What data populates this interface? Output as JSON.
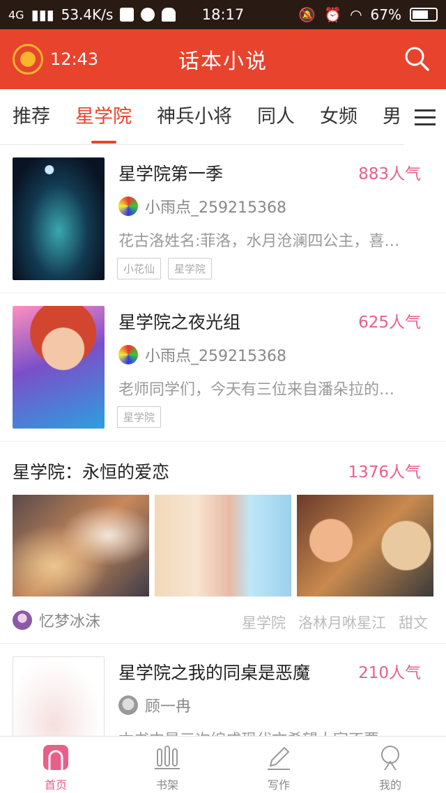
{
  "status_bar": {
    "network": "4G",
    "speed": "53.4K/s",
    "time": "18:17",
    "battery": "67%"
  },
  "header": {
    "timer": "12:43",
    "title": "话本小说"
  },
  "tabs": [
    "推荐",
    "星学院",
    "神兵小将",
    "同人",
    "女频",
    "男"
  ],
  "active_tab": "星学院",
  "books": [
    {
      "title": "星学院第一季",
      "popularity": "883人气",
      "author": "小雨点_259215368",
      "desc": "花古洛姓名:菲洛，水月沧澜四公主，喜…",
      "tags": [
        "小花仙",
        "星学院"
      ]
    },
    {
      "title": "星学院之夜光组",
      "popularity": "625人气",
      "author": "小雨点_259215368",
      "desc": "老师同学们，今天有三位来自潘朵拉的…",
      "tags": [
        "星学院"
      ]
    }
  ],
  "album": {
    "title": "星学院：永恒的爱恋",
    "popularity": "1376人气",
    "author": "忆梦冰沫",
    "tags": [
      "星学院",
      "洛林月咻星江",
      "甜文"
    ]
  },
  "book3": {
    "title": "星学院之我的同桌是恶魔",
    "popularity": "210人气",
    "author": "顾一冉",
    "desc": "本书中是三次编成现代文希望大家不要…"
  },
  "bottom_nav": [
    {
      "label": "首页",
      "icon": "home-icon",
      "active": true
    },
    {
      "label": "书架",
      "icon": "bookshelf-icon",
      "active": false
    },
    {
      "label": "写作",
      "icon": "pen-icon",
      "active": false
    },
    {
      "label": "我的",
      "icon": "profile-icon",
      "active": false
    }
  ],
  "colors": {
    "header": "#e8432d",
    "accent": "#e8432d",
    "popularity": "#e85f8a",
    "statusbar": "#2a1a14"
  }
}
